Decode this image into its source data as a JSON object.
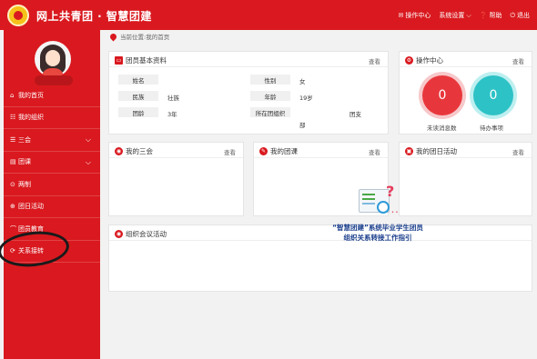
{
  "header": {
    "title": "网上共青团 · 智慧团建",
    "menu": [
      {
        "icon": "mail-icon",
        "label": "操作中心"
      },
      {
        "icon": "settings-icon",
        "label": "系统设置"
      },
      {
        "icon": "help-icon",
        "label": "帮助"
      },
      {
        "icon": "power-icon",
        "label": "退出"
      }
    ]
  },
  "sidebar": {
    "items": [
      {
        "icon": "home-icon",
        "label": "我的首页"
      },
      {
        "icon": "org-icon",
        "label": "我的组织"
      },
      {
        "icon": "list-icon",
        "label": "三会"
      },
      {
        "icon": "folder-icon",
        "label": "团课"
      },
      {
        "icon": "plus-circle-icon",
        "label": "两制"
      },
      {
        "icon": "activity-icon",
        "label": "团日活动"
      },
      {
        "icon": "education-icon",
        "label": "团员教育"
      },
      {
        "icon": "transfer-icon",
        "label": "关系接转"
      }
    ]
  },
  "breadcrumb": "当前位置:我的首页",
  "member_info": {
    "title": "团员基本资料",
    "more": "查看",
    "labels": {
      "name": "姓名",
      "gender": "性别",
      "ethnicity": "民族",
      "age": "年龄",
      "league_age": "团龄",
      "org": "所在团组织"
    },
    "values": {
      "name": "",
      "gender": "女",
      "ethnicity": "壮族",
      "age": "19岁",
      "league_age": "3年",
      "org_a": "团支",
      "org_b": "部"
    }
  },
  "ops_center": {
    "title": "操作中心",
    "more": "查看",
    "unread_count": "0",
    "unread_label": "未读消息数",
    "todo_count": "0",
    "todo_label": "待办事项"
  },
  "panels": {
    "my_three_meetings": {
      "title": "我的三会",
      "more": "查看"
    },
    "my_league_class": {
      "title": "我的团课",
      "more": "查看"
    },
    "my_league_day": {
      "title": "我的团日活动",
      "more": "查看"
    },
    "org_meeting": {
      "title": "组织会议活动"
    }
  },
  "overlay": {
    "line1": "“智慧团建”系统毕业学生团员",
    "line2": "组织关系转接工作指引"
  }
}
